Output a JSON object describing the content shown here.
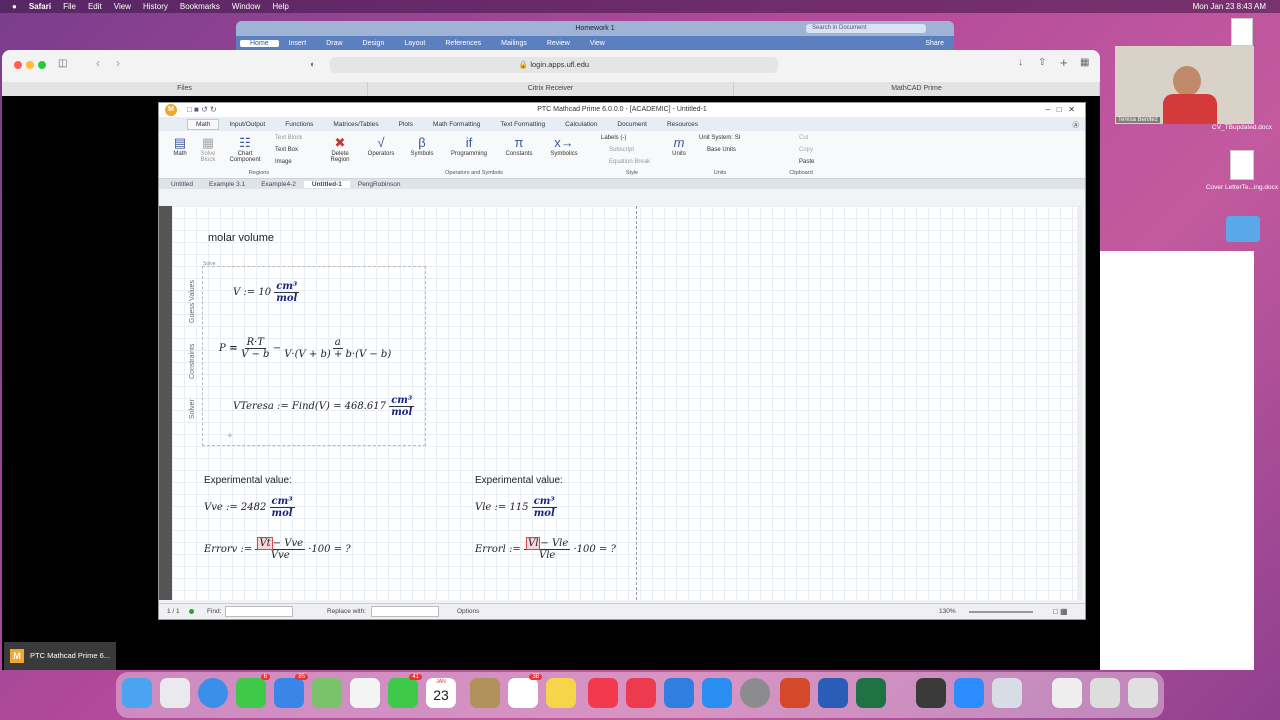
{
  "menubar": {
    "apple": "",
    "app": "Safari",
    "items": [
      "File",
      "Edit",
      "View",
      "History",
      "Bookmarks",
      "Window",
      "Help"
    ],
    "clock": "Mon Jan 23  8:43 AM"
  },
  "word": {
    "title": "Homework 1",
    "tabs": [
      "Home",
      "Insert",
      "Draw",
      "Design",
      "Layout",
      "References",
      "Mailings",
      "Review",
      "View"
    ],
    "search_placeholder": "Search in Document",
    "share": "Share"
  },
  "safari": {
    "url": "login.apps.ufl.edu",
    "tabs": [
      "Files",
      "Citrix Receiver",
      "MathCAD Prime"
    ]
  },
  "mathcad": {
    "title": "PTC Mathcad Prime 6.0.0.0 - [ACADEMIC] - Untitled-1",
    "ribbon_tabs": [
      "Math",
      "Input/Output",
      "Functions",
      "Matrices/Tables",
      "Plots",
      "Math Formatting",
      "Text Formatting",
      "Calculation",
      "Document",
      "Resources"
    ],
    "ribbon": {
      "math": "Math",
      "solve_block": "Solve Block",
      "chart_component": "Chart Component",
      "text_block": "Text Block",
      "text_box": "Text Box",
      "image": "Image",
      "delete_region": "Delete Region",
      "operators": "Operators",
      "symbols": "Symbols",
      "programming": "Programming",
      "constants": "Constants",
      "symbolics": "Symbolics",
      "labels": "Labels",
      "labels_val": "(-)",
      "subscript": "Subscript",
      "equation_break": "Equation Break",
      "units": "Units",
      "unit_system": "Unit System:",
      "unit_system_val": "SI",
      "base_units": "Base Units",
      "cut": "Cut",
      "copy": "Copy",
      "paste": "Paste",
      "grp_regions": "Regions",
      "grp_ops": "Operators and Symbols",
      "grp_style": "Style",
      "grp_units": "Units",
      "grp_clip": "Clipboard"
    },
    "doc_tabs": [
      "Untitled",
      "Example 3.1",
      "Example4-2",
      "Untitled-1",
      "PengRobinson"
    ],
    "canvas": {
      "molar_volume": "molar volume",
      "solve_label": "Solve",
      "guess_label": "Guess Values",
      "constraints_label": "Constraints",
      "solver_label": "Solver",
      "guess_eq": "V := 10",
      "unit_num": "cm³",
      "unit_den": "mol",
      "p_lhs": "P",
      "p_frac1_num": "R·T",
      "p_frac1_den": "V − b",
      "p_frac2_num": "a",
      "p_frac2_den": "V·(V + b) + b·(V − b)",
      "solver_eq": "VTeresa := Find(V) = 468.617",
      "exp_left": "Experimental value:",
      "exp_right": "Experimental value:",
      "vve": "Vve := 2482",
      "vle": "Vle := 115",
      "errorv_lhs": "Errorv :=",
      "errorv_num_ph": "Vt",
      "errorv_num_rest": "− Vve",
      "errorv_den": "Vve",
      "errorv_tail": "·100 = ?",
      "errorl_lhs": "Errorl :=",
      "errorl_num_ph": "Vl",
      "errorl_num_rest": "− Vle",
      "errorl_den": "Vle",
      "errorl_tail": "·100 = ?"
    },
    "status": {
      "page": "1 / 1",
      "find": "Find:",
      "replace": "Replace with:",
      "options": "Options",
      "zoom": "130%"
    }
  },
  "webcam": {
    "name": "Teresa Benitez"
  },
  "desktop": {
    "files": [
      "CV_TBupdated.docx",
      "Cover LetterTe...ing.docx"
    ]
  },
  "taskbar": {
    "label": "PTC Mathcad Prime 6..."
  },
  "dock": {
    "badges": {
      "messages": "6",
      "mail": "85",
      "facetime": "41",
      "reminders": "38"
    },
    "calendar_month": "JAN",
    "calendar_day": "23"
  }
}
